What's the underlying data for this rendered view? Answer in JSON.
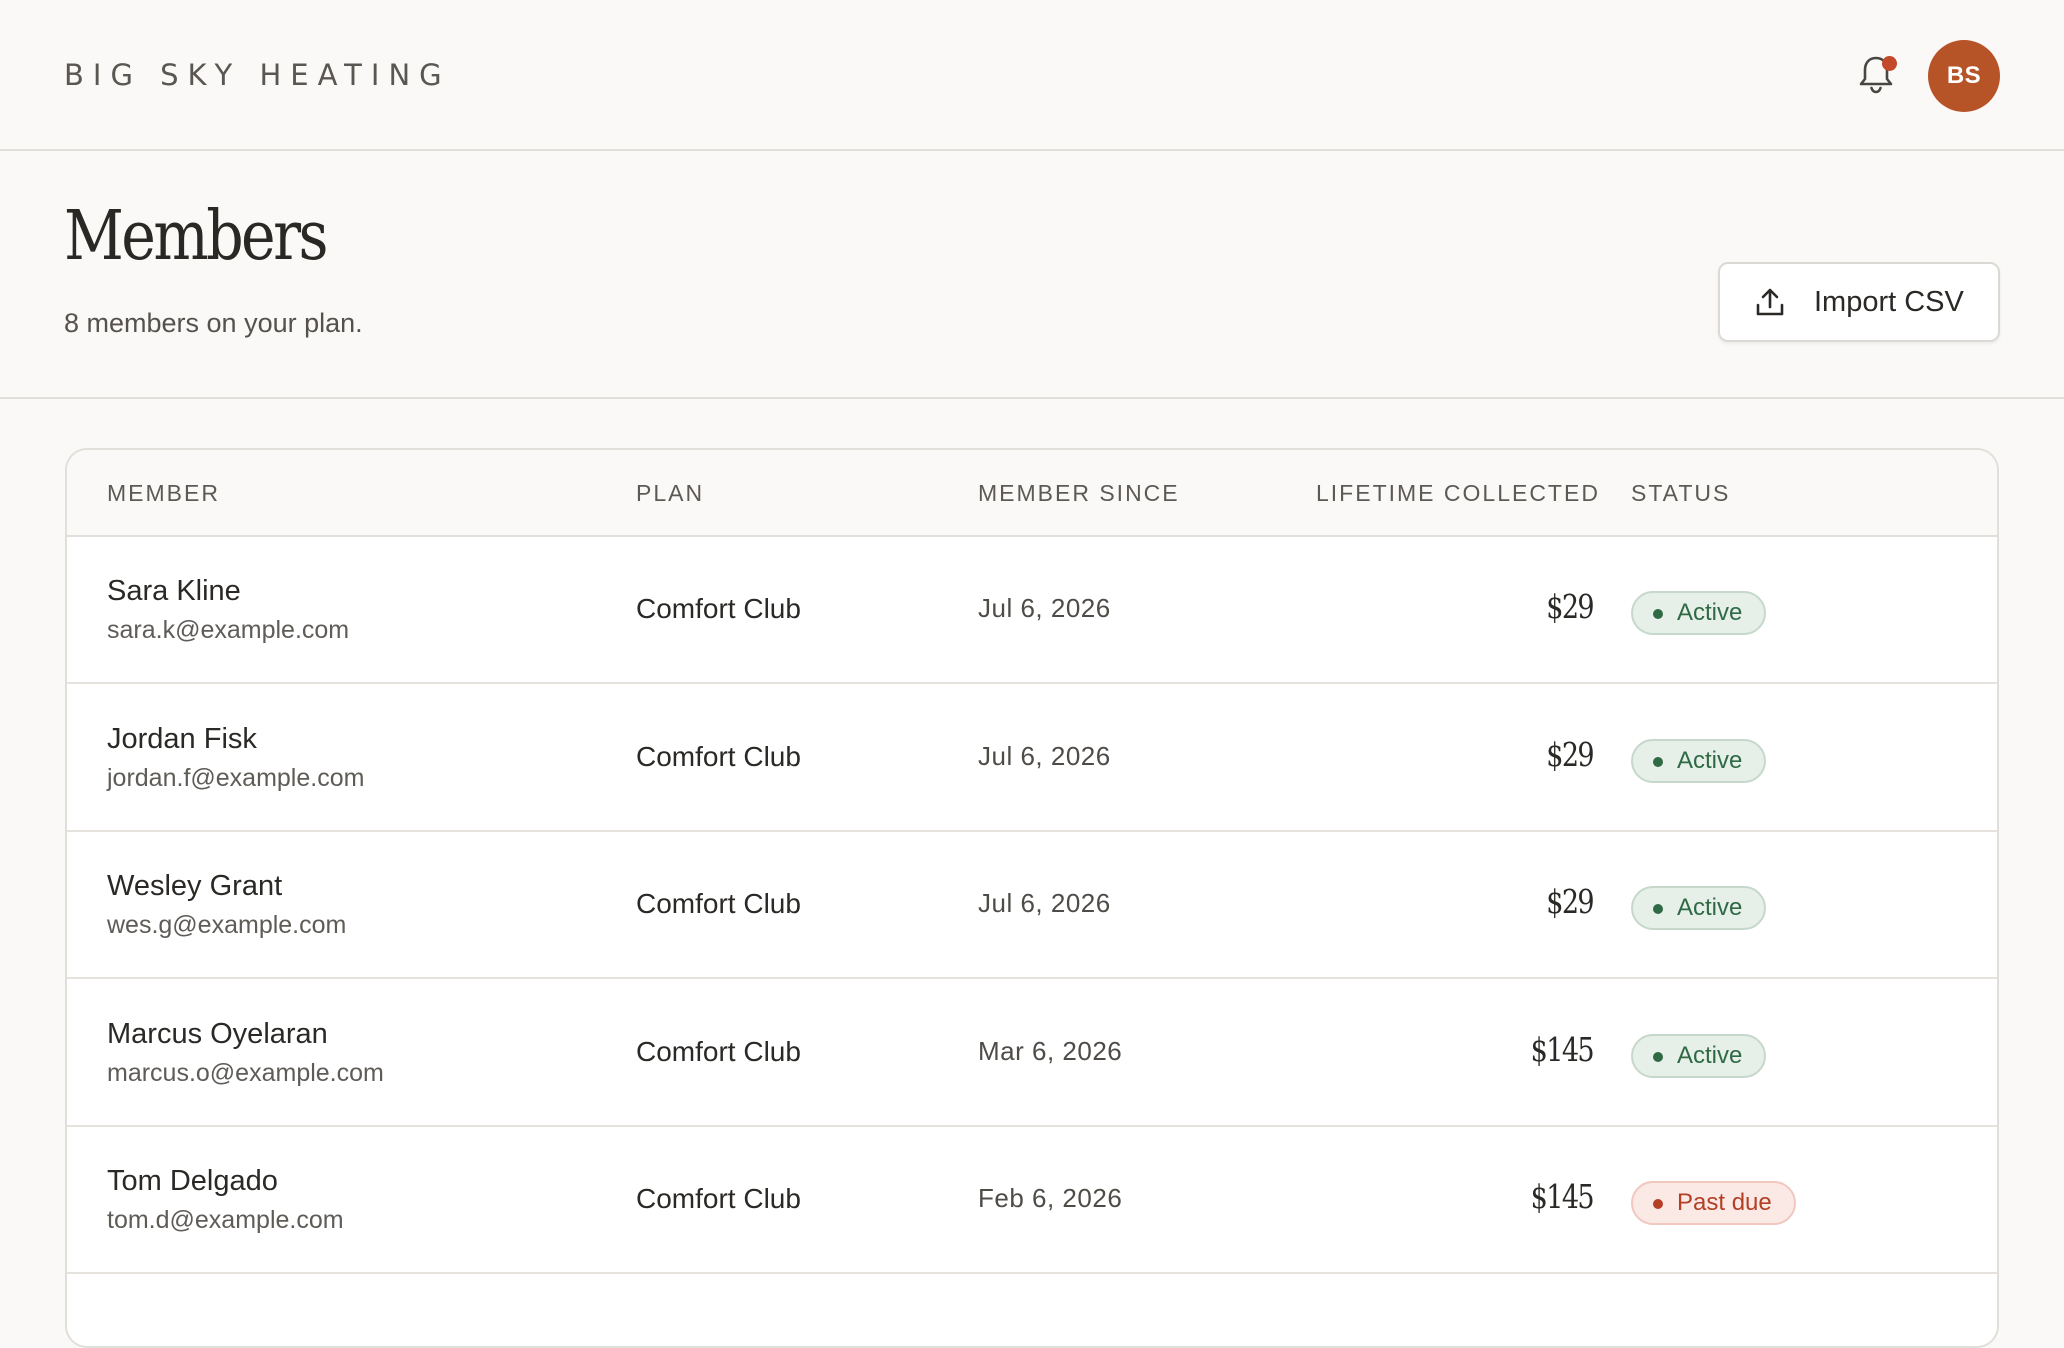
{
  "brand": "BIG SKY HEATING",
  "user": {
    "initials": "BS"
  },
  "page": {
    "title": "Members",
    "subtitle": "8 members on your plan.",
    "import_label": "Import CSV"
  },
  "table": {
    "columns": [
      "Member",
      "Plan",
      "Member since",
      "Lifetime collected",
      "Status"
    ],
    "rows": [
      {
        "name": "Sara Kline",
        "email": "sara.k@example.com",
        "plan": "Comfort Club",
        "since": "Jul 6, 2026",
        "collected": "$29",
        "status": "Active"
      },
      {
        "name": "Jordan Fisk",
        "email": "jordan.f@example.com",
        "plan": "Comfort Club",
        "since": "Jul 6, 2026",
        "collected": "$29",
        "status": "Active"
      },
      {
        "name": "Wesley Grant",
        "email": "wes.g@example.com",
        "plan": "Comfort Club",
        "since": "Jul 6, 2026",
        "collected": "$29",
        "status": "Active"
      },
      {
        "name": "Marcus Oyelaran",
        "email": "marcus.o@example.com",
        "plan": "Comfort Club",
        "since": "Mar 6, 2026",
        "collected": "$145",
        "status": "Active"
      },
      {
        "name": "Tom Delgado",
        "email": "tom.d@example.com",
        "plan": "Comfort Club",
        "since": "Feb 6, 2026",
        "collected": "$145",
        "status": "Past due"
      }
    ]
  },
  "icons": {
    "notifications": "bell-icon",
    "import": "upload-icon",
    "row_open": "chevron-right-icon"
  },
  "colors": {
    "accent": "#b65428",
    "notification_dot": "#c2492a",
    "active": "#2f6a45",
    "past_due": "#b33f25"
  }
}
